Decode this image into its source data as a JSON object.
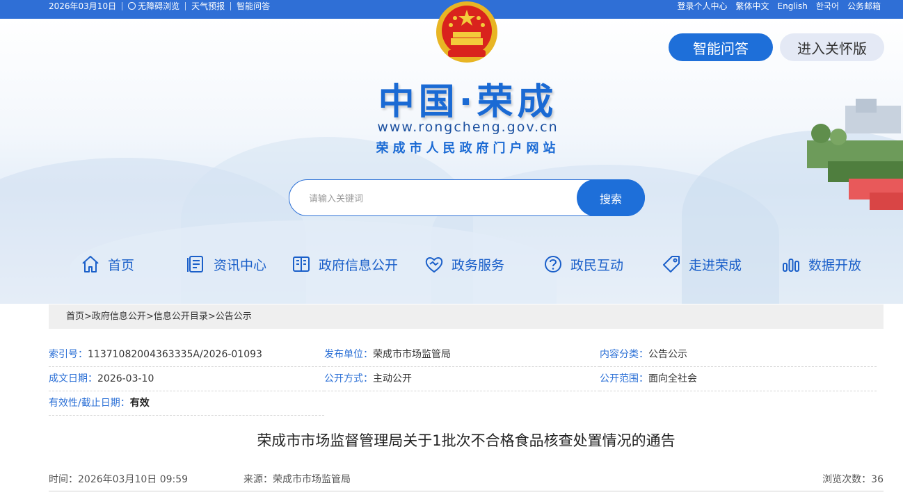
{
  "topbar": {
    "date": "2026年03月10日",
    "accessible": "无障碍浏览",
    "weather": "天气预报",
    "qa": "智能问答",
    "login": "登录个人中心",
    "traditional": "繁体中文",
    "english": "English",
    "korean": "한국어",
    "mail": "公务邮箱"
  },
  "header": {
    "ai_button": "智能问答",
    "care_button": "进入关怀版",
    "logo_main": "中国·荣成",
    "logo_url": "www.rongcheng.gov.cn",
    "logo_sub": "荣成市人民政府门户网站"
  },
  "search": {
    "placeholder": "请输入关键词",
    "button": "搜索"
  },
  "nav": {
    "items": [
      {
        "label": "首页",
        "icon": "home-icon"
      },
      {
        "label": "资讯中心",
        "icon": "news-icon"
      },
      {
        "label": "政府信息公开",
        "icon": "book-icon"
      },
      {
        "label": "政务服务",
        "icon": "handshake-icon"
      },
      {
        "label": "政民互动",
        "icon": "question-icon"
      },
      {
        "label": "走进荣成",
        "icon": "tag-icon"
      },
      {
        "label": "数据开放",
        "icon": "chart-icon"
      }
    ]
  },
  "breadcrumb": {
    "home": "首页",
    "l1": "政府信息公开",
    "l2": "信息公开目录",
    "l3": "公告公示",
    "sep": ">"
  },
  "meta": {
    "index_key": "索引号：",
    "index_val": "11371082004363335A/2026-01093",
    "publisher_key": "发布单位：",
    "publisher_val": "荣成市市场监管局",
    "category_key": "内容分类：",
    "category_val": "公告公示",
    "date_key": "成文日期：",
    "date_val": "2026-03-10",
    "mode_key": "公开方式：",
    "mode_val": "主动公开",
    "scope_key": "公开范围：",
    "scope_val": "面向全社会",
    "validity_key": "有效性/截止日期：",
    "validity_val": "有效"
  },
  "article": {
    "title": "荣成市市场监督管理局关于1批次不合格食品核查处置情况的通告",
    "time": "时间：2026年03月10日 09:59",
    "source": "来源：荣成市市场监管局",
    "views": "浏览次数：36"
  },
  "colors": {
    "primary": "#1e6fd9",
    "topbar": "#2f6fd6",
    "label": "#2a6fd6"
  }
}
